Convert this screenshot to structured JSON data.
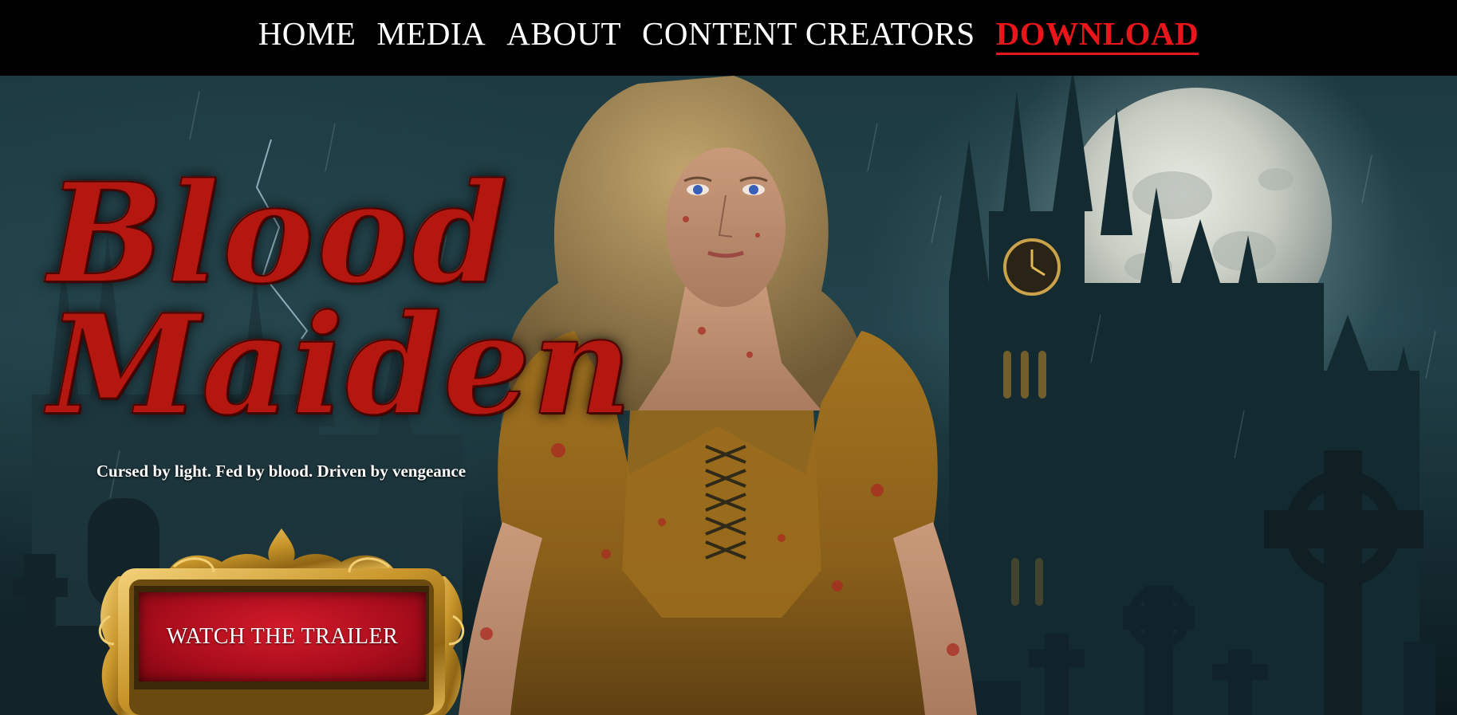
{
  "nav": {
    "items": [
      {
        "label": "HOME"
      },
      {
        "label": "MEDIA"
      },
      {
        "label": "ABOUT"
      },
      {
        "label": "CONTENT CREATORS"
      },
      {
        "label": "DOWNLOAD"
      }
    ],
    "active_label": "DOWNLOAD"
  },
  "hero": {
    "title_line_1": "Blood",
    "title_line_2": "Maiden",
    "tagline": "Cursed by light. Fed by blood. Driven by vengeance",
    "cta_label": "WATCH THE TRAILER"
  },
  "colors": {
    "nav_background": "#000000",
    "nav_text": "#ffffff",
    "nav_active": "#e8151b",
    "title_red": "#b3170f",
    "button_red": "#a90d1c",
    "frame_gold": "#c9962b"
  }
}
